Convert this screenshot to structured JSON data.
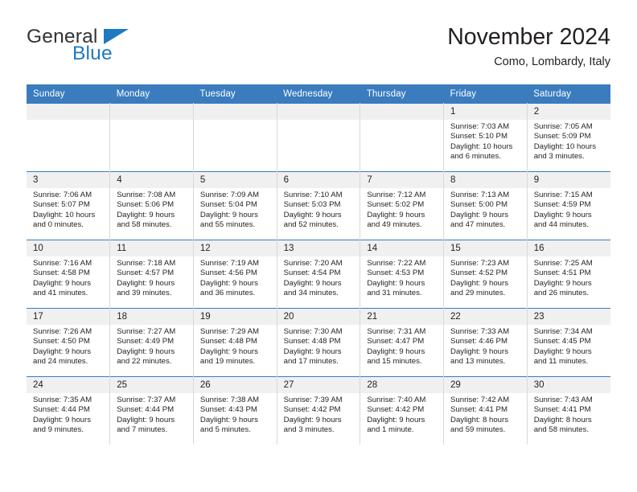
{
  "logo": {
    "word_top": "General",
    "word_bottom": "Blue",
    "triangle_icon": "blue-triangle-icon",
    "accent_color": "#1f7ac0"
  },
  "header": {
    "title": "November 2024",
    "subtitle": "Como, Lombardy, Italy"
  },
  "theme": {
    "header_row_bg": "#3a7cbe",
    "daynum_bg": "#f0f0f0",
    "text_color": "#231f20"
  },
  "calendar": {
    "weekday_headers": [
      "Sunday",
      "Monday",
      "Tuesday",
      "Wednesday",
      "Thursday",
      "Friday",
      "Saturday"
    ],
    "weeks": [
      [
        {
          "day": "",
          "lines": []
        },
        {
          "day": "",
          "lines": []
        },
        {
          "day": "",
          "lines": []
        },
        {
          "day": "",
          "lines": []
        },
        {
          "day": "",
          "lines": []
        },
        {
          "day": "1",
          "lines": [
            "Sunrise: 7:03 AM",
            "Sunset: 5:10 PM",
            "Daylight: 10 hours",
            "and 6 minutes."
          ]
        },
        {
          "day": "2",
          "lines": [
            "Sunrise: 7:05 AM",
            "Sunset: 5:09 PM",
            "Daylight: 10 hours",
            "and 3 minutes."
          ]
        }
      ],
      [
        {
          "day": "3",
          "lines": [
            "Sunrise: 7:06 AM",
            "Sunset: 5:07 PM",
            "Daylight: 10 hours",
            "and 0 minutes."
          ]
        },
        {
          "day": "4",
          "lines": [
            "Sunrise: 7:08 AM",
            "Sunset: 5:06 PM",
            "Daylight: 9 hours",
            "and 58 minutes."
          ]
        },
        {
          "day": "5",
          "lines": [
            "Sunrise: 7:09 AM",
            "Sunset: 5:04 PM",
            "Daylight: 9 hours",
            "and 55 minutes."
          ]
        },
        {
          "day": "6",
          "lines": [
            "Sunrise: 7:10 AM",
            "Sunset: 5:03 PM",
            "Daylight: 9 hours",
            "and 52 minutes."
          ]
        },
        {
          "day": "7",
          "lines": [
            "Sunrise: 7:12 AM",
            "Sunset: 5:02 PM",
            "Daylight: 9 hours",
            "and 49 minutes."
          ]
        },
        {
          "day": "8",
          "lines": [
            "Sunrise: 7:13 AM",
            "Sunset: 5:00 PM",
            "Daylight: 9 hours",
            "and 47 minutes."
          ]
        },
        {
          "day": "9",
          "lines": [
            "Sunrise: 7:15 AM",
            "Sunset: 4:59 PM",
            "Daylight: 9 hours",
            "and 44 minutes."
          ]
        }
      ],
      [
        {
          "day": "10",
          "lines": [
            "Sunrise: 7:16 AM",
            "Sunset: 4:58 PM",
            "Daylight: 9 hours",
            "and 41 minutes."
          ]
        },
        {
          "day": "11",
          "lines": [
            "Sunrise: 7:18 AM",
            "Sunset: 4:57 PM",
            "Daylight: 9 hours",
            "and 39 minutes."
          ]
        },
        {
          "day": "12",
          "lines": [
            "Sunrise: 7:19 AM",
            "Sunset: 4:56 PM",
            "Daylight: 9 hours",
            "and 36 minutes."
          ]
        },
        {
          "day": "13",
          "lines": [
            "Sunrise: 7:20 AM",
            "Sunset: 4:54 PM",
            "Daylight: 9 hours",
            "and 34 minutes."
          ]
        },
        {
          "day": "14",
          "lines": [
            "Sunrise: 7:22 AM",
            "Sunset: 4:53 PM",
            "Daylight: 9 hours",
            "and 31 minutes."
          ]
        },
        {
          "day": "15",
          "lines": [
            "Sunrise: 7:23 AM",
            "Sunset: 4:52 PM",
            "Daylight: 9 hours",
            "and 29 minutes."
          ]
        },
        {
          "day": "16",
          "lines": [
            "Sunrise: 7:25 AM",
            "Sunset: 4:51 PM",
            "Daylight: 9 hours",
            "and 26 minutes."
          ]
        }
      ],
      [
        {
          "day": "17",
          "lines": [
            "Sunrise: 7:26 AM",
            "Sunset: 4:50 PM",
            "Daylight: 9 hours",
            "and 24 minutes."
          ]
        },
        {
          "day": "18",
          "lines": [
            "Sunrise: 7:27 AM",
            "Sunset: 4:49 PM",
            "Daylight: 9 hours",
            "and 22 minutes."
          ]
        },
        {
          "day": "19",
          "lines": [
            "Sunrise: 7:29 AM",
            "Sunset: 4:48 PM",
            "Daylight: 9 hours",
            "and 19 minutes."
          ]
        },
        {
          "day": "20",
          "lines": [
            "Sunrise: 7:30 AM",
            "Sunset: 4:48 PM",
            "Daylight: 9 hours",
            "and 17 minutes."
          ]
        },
        {
          "day": "21",
          "lines": [
            "Sunrise: 7:31 AM",
            "Sunset: 4:47 PM",
            "Daylight: 9 hours",
            "and 15 minutes."
          ]
        },
        {
          "day": "22",
          "lines": [
            "Sunrise: 7:33 AM",
            "Sunset: 4:46 PM",
            "Daylight: 9 hours",
            "and 13 minutes."
          ]
        },
        {
          "day": "23",
          "lines": [
            "Sunrise: 7:34 AM",
            "Sunset: 4:45 PM",
            "Daylight: 9 hours",
            "and 11 minutes."
          ]
        }
      ],
      [
        {
          "day": "24",
          "lines": [
            "Sunrise: 7:35 AM",
            "Sunset: 4:44 PM",
            "Daylight: 9 hours",
            "and 9 minutes."
          ]
        },
        {
          "day": "25",
          "lines": [
            "Sunrise: 7:37 AM",
            "Sunset: 4:44 PM",
            "Daylight: 9 hours",
            "and 7 minutes."
          ]
        },
        {
          "day": "26",
          "lines": [
            "Sunrise: 7:38 AM",
            "Sunset: 4:43 PM",
            "Daylight: 9 hours",
            "and 5 minutes."
          ]
        },
        {
          "day": "27",
          "lines": [
            "Sunrise: 7:39 AM",
            "Sunset: 4:42 PM",
            "Daylight: 9 hours",
            "and 3 minutes."
          ]
        },
        {
          "day": "28",
          "lines": [
            "Sunrise: 7:40 AM",
            "Sunset: 4:42 PM",
            "Daylight: 9 hours",
            "and 1 minute."
          ]
        },
        {
          "day": "29",
          "lines": [
            "Sunrise: 7:42 AM",
            "Sunset: 4:41 PM",
            "Daylight: 8 hours",
            "and 59 minutes."
          ]
        },
        {
          "day": "30",
          "lines": [
            "Sunrise: 7:43 AM",
            "Sunset: 4:41 PM",
            "Daylight: 8 hours",
            "and 58 minutes."
          ]
        }
      ]
    ]
  }
}
